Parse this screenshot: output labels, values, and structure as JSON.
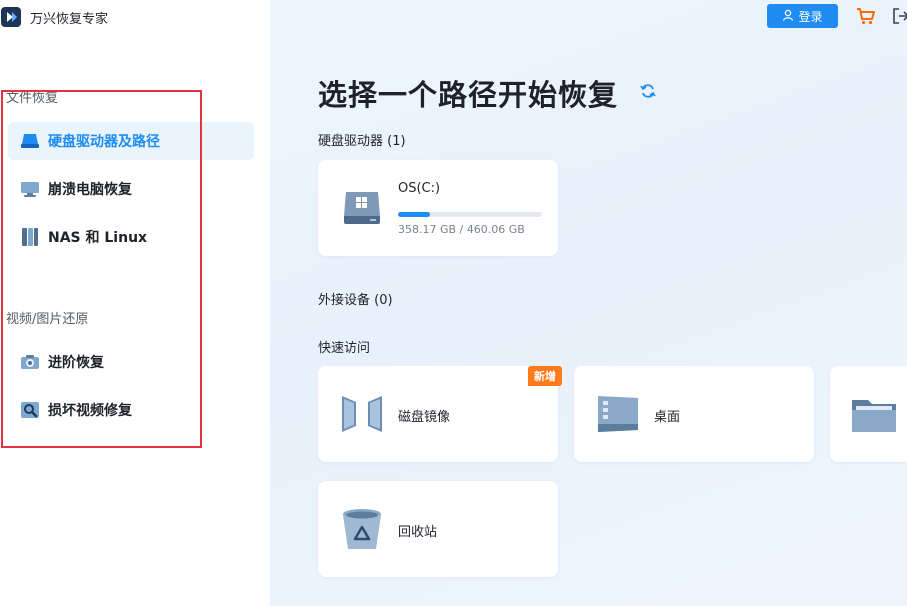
{
  "app": {
    "title": "万兴恢复专家"
  },
  "sidebar": {
    "sections": [
      {
        "label": "文件恢复"
      },
      {
        "label": "视频/图片还原"
      }
    ],
    "items": [
      {
        "label": "硬盘驱动器及路径",
        "icon": "drive-icon",
        "active": true
      },
      {
        "label": "崩溃电脑恢复",
        "icon": "monitor-icon",
        "active": false
      },
      {
        "label": "NAS 和 Linux",
        "icon": "nas-icon",
        "active": false
      },
      {
        "label": "进阶恢复",
        "icon": "camera-icon",
        "active": false
      },
      {
        "label": "损坏视频修复",
        "icon": "video-repair-icon",
        "active": false
      }
    ]
  },
  "header": {
    "login_label": "登录",
    "cart_icon": "cart-icon",
    "logout_icon": "logout-icon"
  },
  "main": {
    "title": "选择一个路径开始恢复",
    "drives_label": "硬盘驱动器 (1)",
    "drives": [
      {
        "name": "OS(C:)",
        "used": "358.17 GB",
        "total": "460.06 GB",
        "size_text": "358.17 GB / 460.06 GB",
        "usage_fraction": 0.22
      }
    ],
    "external_label": "外接设备 (0)",
    "quick_label": "快速访问",
    "quick_access": [
      {
        "label": "磁盘镜像",
        "badge": "新增",
        "icon": "disk-image-icon"
      },
      {
        "label": "桌面",
        "icon": "desktop-icon"
      },
      {
        "label": "",
        "icon": "folder-icon"
      },
      {
        "label": "回收站",
        "icon": "recycle-bin-icon"
      }
    ]
  },
  "colors": {
    "accent": "#1e8cf0",
    "badge": "#ff7a1a",
    "highlight": "#e03540"
  }
}
